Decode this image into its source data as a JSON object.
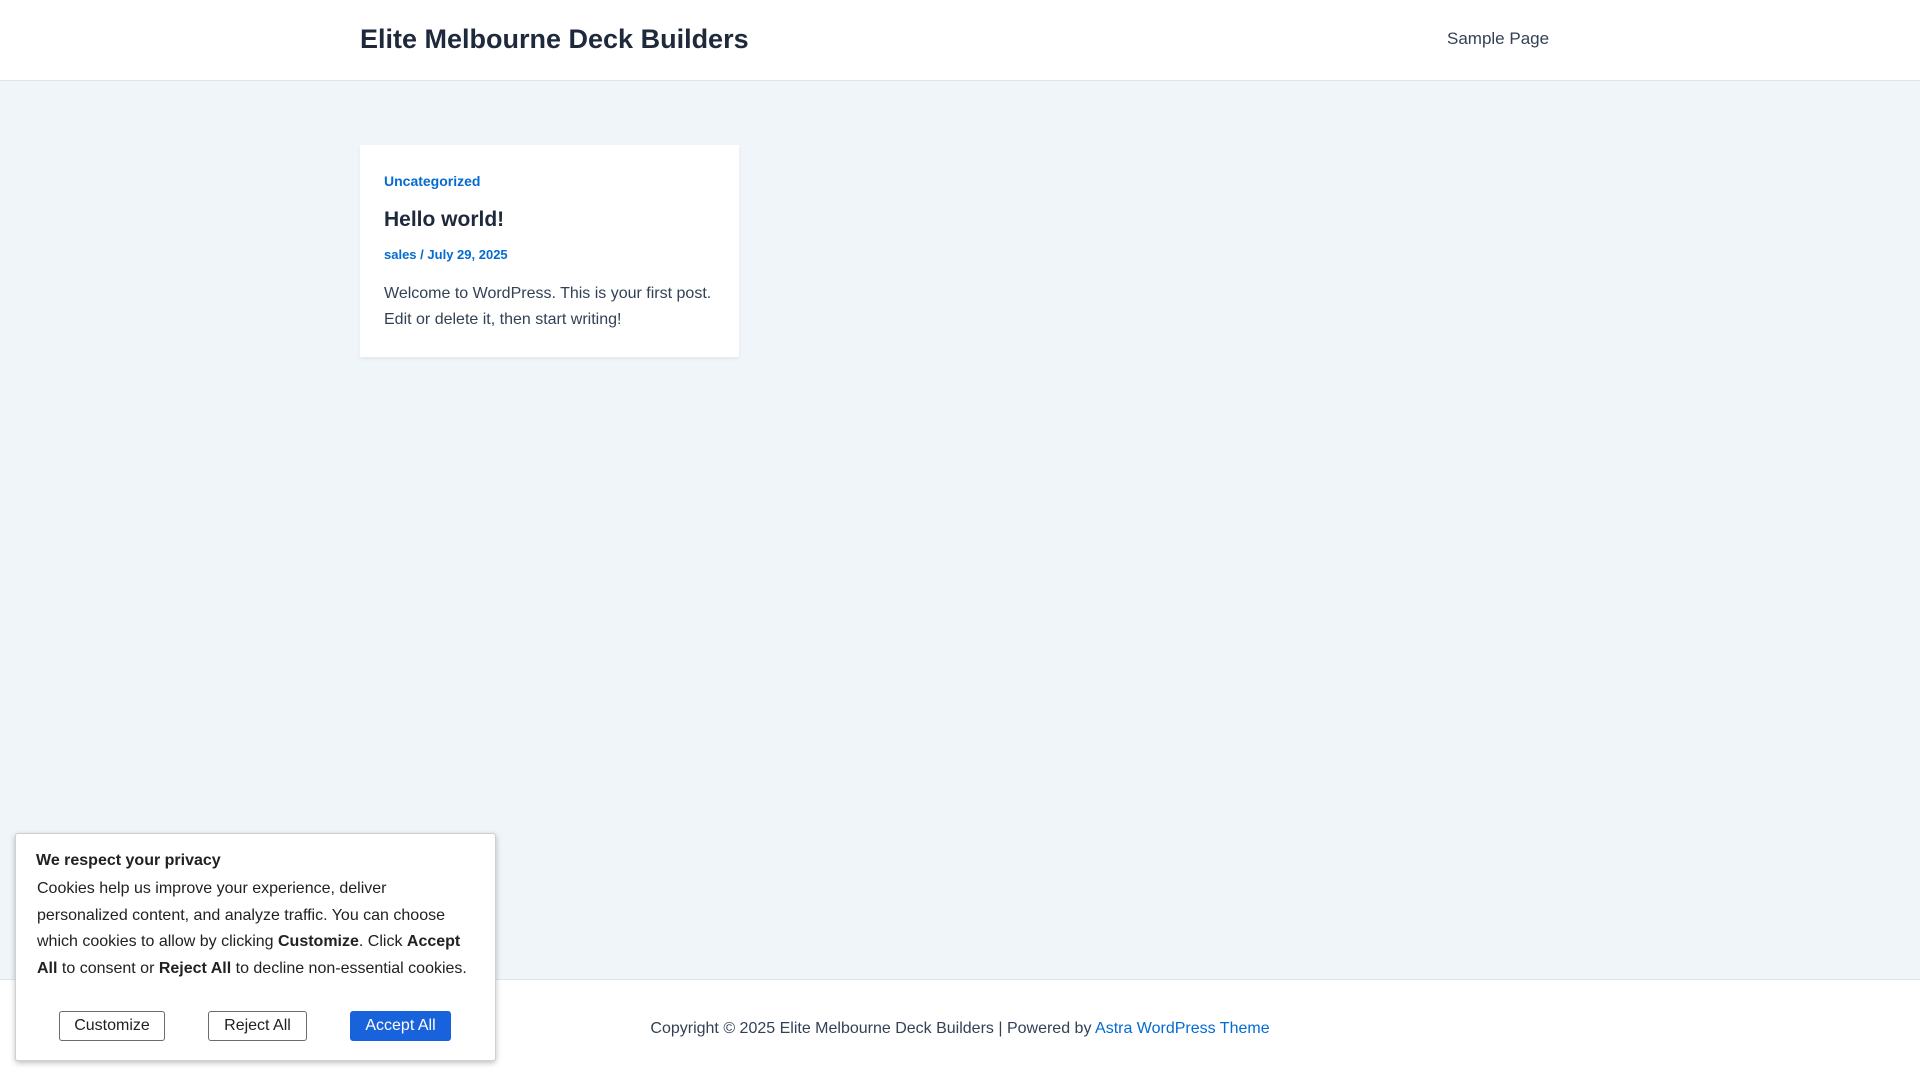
{
  "header": {
    "site_title": "Elite Melbourne Deck Builders",
    "nav": [
      {
        "label": "Sample Page"
      }
    ]
  },
  "post": {
    "category": "Uncategorized",
    "title": "Hello world!",
    "author": "sales",
    "separator": "/",
    "date": "July 29, 2025",
    "excerpt": "Welcome to WordPress. This is your first post. Edit or delete it, then start writing!"
  },
  "footer": {
    "copyright": "Copyright © 2025 Elite Melbourne Deck Builders | Powered by",
    "theme_link": "Astra WordPress Theme"
  },
  "cookie_banner": {
    "title": "We respect your privacy",
    "text_parts": [
      "Cookies help us improve your experience, deliver personalized content, and analyze traffic. You can choose which cookies to allow by clicking ",
      "Customize",
      ". Click ",
      "Accept All",
      " to consent or ",
      "Reject All",
      " to decline non-essential cookies."
    ],
    "buttons": {
      "customize": "Customize",
      "reject": "Reject All",
      "accept": "Accept All"
    }
  },
  "colors": {
    "accent": "#046bd2",
    "background": "#f0f5fa",
    "heading": "#1e293b",
    "text": "#334155",
    "accept_button": "#1863dc"
  }
}
